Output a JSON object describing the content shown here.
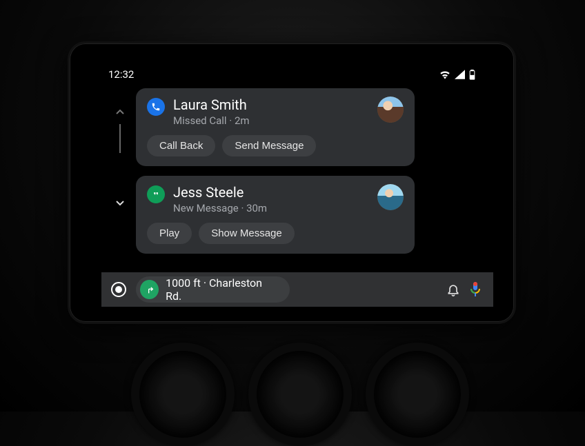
{
  "status": {
    "time": "12:32"
  },
  "cards": [
    {
      "app_icon": "phone-icon",
      "app_color": "#1a73e8",
      "title": "Laura Smith",
      "subtitle": "Missed Call · 2m",
      "actions": [
        "Call Back",
        "Send Message"
      ]
    },
    {
      "app_icon": "hangouts-icon",
      "app_color": "#0f9d58",
      "title": "Jess Steele",
      "subtitle": "New Message · 30m",
      "actions": [
        "Play",
        "Show Message"
      ]
    }
  ],
  "nav": {
    "text": "1000 ft · Charleston Rd."
  }
}
